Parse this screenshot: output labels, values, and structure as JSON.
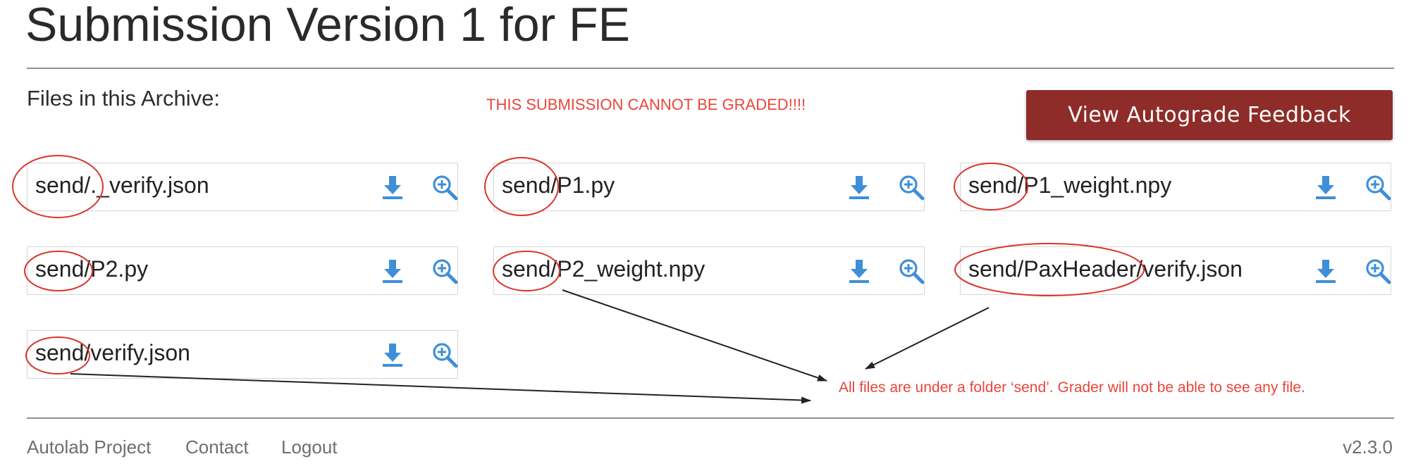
{
  "page": {
    "title": "Submission Version 1 for FE"
  },
  "archive": {
    "label": "Files in this Archive:",
    "warning": "THIS SUBMISSION CANNOT BE GRADED!!!!",
    "feedback_button": "View Autograde Feedback",
    "files": [
      {
        "name": "send/._verify.json",
        "download_icon": "download-icon",
        "view_icon": "zoom-in-icon"
      },
      {
        "name": "send/P1.py",
        "download_icon": "download-icon",
        "view_icon": "zoom-in-icon"
      },
      {
        "name": "send/P1_weight.npy",
        "download_icon": "download-icon",
        "view_icon": "zoom-in-icon"
      },
      {
        "name": "send/P2.py",
        "download_icon": "download-icon",
        "view_icon": "zoom-in-icon"
      },
      {
        "name": "send/P2_weight.npy",
        "download_icon": "download-icon",
        "view_icon": "zoom-in-icon"
      },
      {
        "name": "send/PaxHeader/verify.json",
        "download_icon": "download-icon",
        "view_icon": "zoom-in-icon"
      },
      {
        "name": "send/verify.json",
        "download_icon": "download-icon",
        "view_icon": "zoom-in-icon"
      }
    ]
  },
  "annotation": {
    "note": "All files are under a folder ‘send’. Grader will not be able to see any file."
  },
  "footer": {
    "links": [
      "Autolab Project",
      "Contact",
      "Logout"
    ],
    "version": "v2.3.0"
  },
  "colors": {
    "primary_button": "#8e2c29",
    "icon_blue": "#3f8fd8",
    "warning_red": "#e8463a",
    "annotation_ellipse": "#d9352b",
    "arrow": "#222222"
  }
}
